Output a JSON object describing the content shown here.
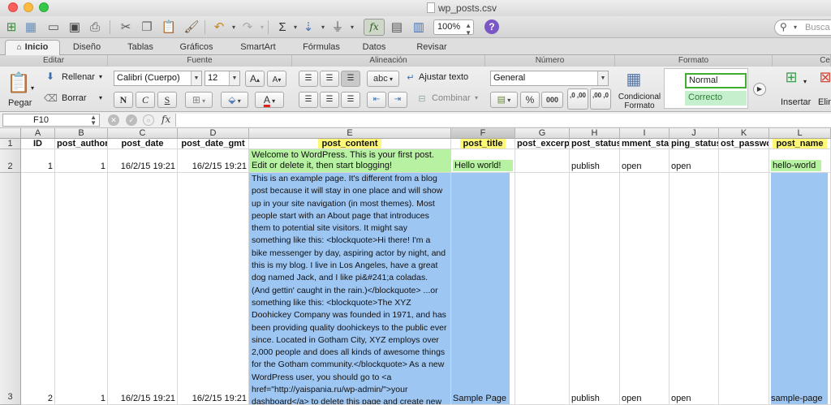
{
  "window": {
    "title": "wp_posts.csv"
  },
  "toolbar": {
    "zoom": "100%",
    "search_placeholder": "Busca",
    "fx": "fx",
    "help": "?"
  },
  "tabs": [
    "Inicio",
    "Diseño",
    "Tablas",
    "Gráficos",
    "SmartArt",
    "Fórmulas",
    "Datos",
    "Revisar"
  ],
  "ribbon": {
    "groups": {
      "editar": "Editar",
      "fuente": "Fuente",
      "alineacion": "Alineación",
      "numero": "Número",
      "formato": "Formato",
      "celdas": "Ce"
    },
    "pegar": "Pegar",
    "rellenar": "Rellenar",
    "borrar": "Borrar",
    "font_name": "Calibri (Cuerpo)",
    "font_size": "12",
    "bold": "N",
    "italic": "C",
    "underline": "S",
    "grow": "A",
    "shrink": "A",
    "font_color": "A",
    "wrap_label": "abc",
    "ajustar_texto": "Ajustar texto",
    "combinar": "Combinar",
    "number_format": "General",
    "percent": "%",
    "thousands": "000",
    "dec_inc": ",0 ,00",
    "dec_dec": ",00 ,0",
    "cond_format": [
      "Condicional",
      "Formato"
    ],
    "style_normal": "Normal",
    "style_correcto": "Correcto",
    "insertar": "Insertar",
    "eliminar": "Elin",
    "colors": {
      "normal_border": "#3fae2f",
      "correcto_fill": "#c6efce",
      "correcto_text": "#2e7d32"
    }
  },
  "formula_bar": {
    "cell_ref": "F10",
    "fx": "fx",
    "value": ""
  },
  "grid": {
    "columns": [
      "A",
      "B",
      "C",
      "D",
      "E",
      "F",
      "G",
      "H",
      "I",
      "J",
      "K",
      "L"
    ],
    "rows": [
      "1",
      "2",
      "3"
    ],
    "headers": [
      "ID",
      "post_author",
      "post_date",
      "post_date_gmt",
      "post_content",
      "post_title",
      "post_excerpt",
      "post_status",
      "mment_stat",
      "ping_status",
      "ost_passwor",
      "post_name"
    ],
    "row2": {
      "id": "1",
      "author": "1",
      "date": "16/2/15 19:21",
      "date_gmt": "16/2/15 19:21",
      "content": "Welcome to WordPress. This is your first post. Edit or delete it, then start blogging!",
      "title": "Hello world!",
      "excerpt": "",
      "status": "publish",
      "comment": "open",
      "ping": "open",
      "password": "",
      "name": "hello-world"
    },
    "row3": {
      "id": "2",
      "author": "1",
      "date": "16/2/15 19:21",
      "date_gmt": "16/2/15 19:21",
      "content": "This is an example page. It's different from a blog post because it will stay in one place and will show up in your site navigation (in most themes). Most people start with an About page that introduces them to potential site visitors. It might say something like this: <blockquote>Hi there! I'm a bike messenger by day, aspiring actor by night, and this is my blog. I live in Los Angeles, have a great dog named Jack, and I like pi&#241;a coladas. (And gettin' caught in the rain.)</blockquote> ...or something like this: <blockquote>The XYZ Doohickey Company was founded in 1971, and has been providing quality doohickeys to the public ever since. Located in Gotham City, XYZ employs over 2,000 people and does all kinds of awesome things for the Gotham community.</blockquote> As a new WordPress user, you should go to <a href=\"http://yaispania.ru/wp-admin/\">your dashboard</a> to delete this page and create new pages for your content. Have fun!",
      "title": "Sample Page",
      "excerpt": "",
      "status": "publish",
      "comment": "open",
      "ping": "open",
      "password": "",
      "name": "sample-page"
    },
    "colors": {
      "yellow": "#fff776",
      "green": "#b6f2a1",
      "blue": "#9ec6f3"
    }
  },
  "icons": [
    "new-sheet-icon",
    "templates-icon",
    "open-icon",
    "save-icon",
    "print-icon",
    "cut-icon",
    "copy-icon",
    "paste-icon",
    "format-painter-icon",
    "undo-icon",
    "redo-icon",
    "autosum-icon",
    "fill-icon",
    "filter-icon",
    "fx-icon",
    "gallery-icon",
    "toolbox-icon",
    "help-icon",
    "search-icon"
  ]
}
